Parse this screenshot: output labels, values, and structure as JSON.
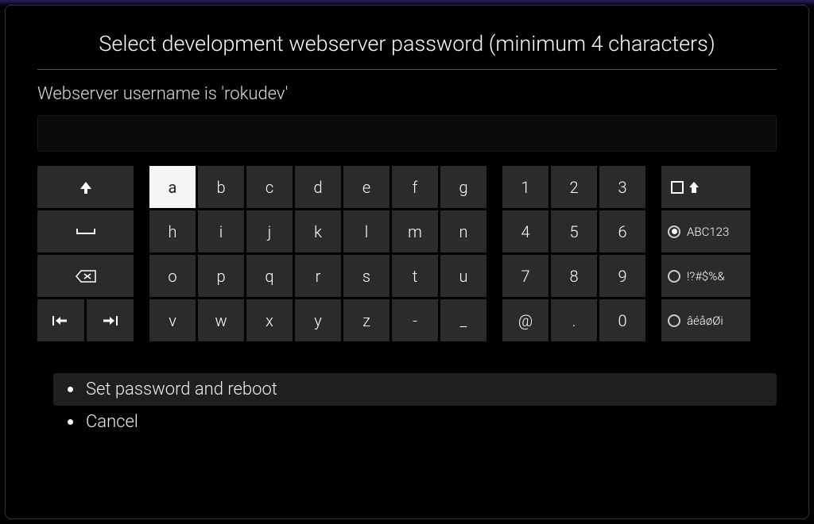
{
  "title": "Select development webserver password (minimum 4 characters)",
  "subtitle": "Webserver username is 'rokudev'",
  "input_value": "",
  "selected_key": "a",
  "selected_mode_index": 1,
  "keyboard": {
    "letters": [
      "a",
      "b",
      "c",
      "d",
      "e",
      "f",
      "g",
      "h",
      "i",
      "j",
      "k",
      "l",
      "m",
      "n",
      "o",
      "p",
      "q",
      "r",
      "s",
      "t",
      "u",
      "v",
      "w",
      "x",
      "y",
      "z",
      "-",
      "_"
    ],
    "numbers": [
      "1",
      "2",
      "3",
      "4",
      "5",
      "6",
      "7",
      "8",
      "9",
      "@",
      ".",
      "0"
    ],
    "modes": [
      "",
      "ABC123",
      "!?#$%&",
      "âéåøØi"
    ]
  },
  "options": [
    {
      "label": "Set password and reboot",
      "highlight": true
    },
    {
      "label": "Cancel",
      "highlight": false
    }
  ]
}
